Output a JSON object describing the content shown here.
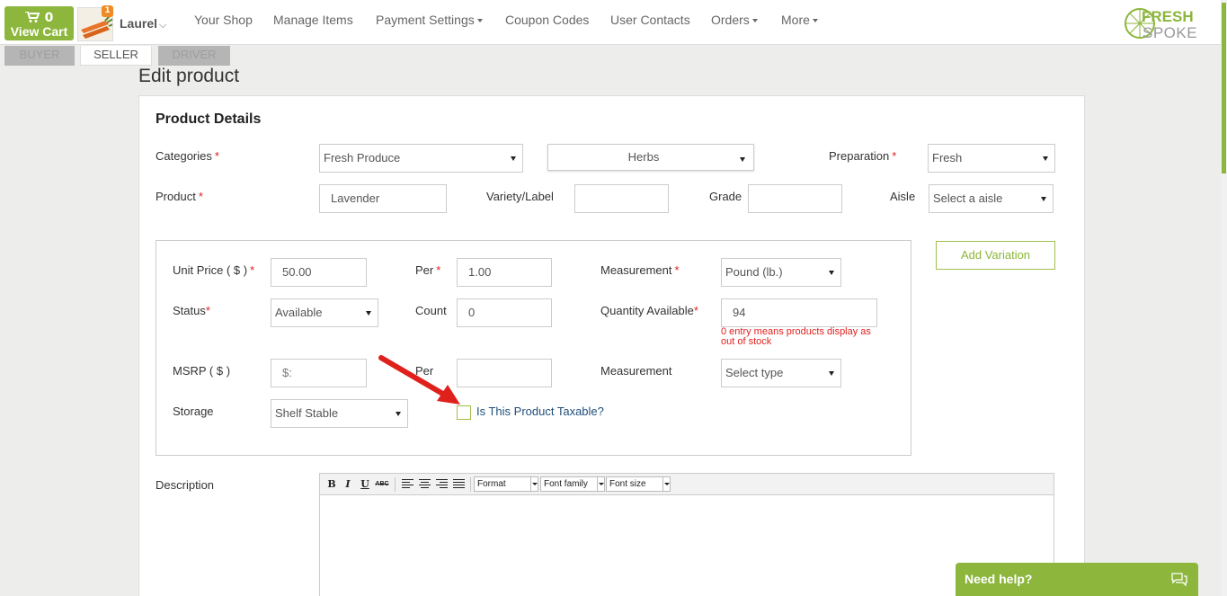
{
  "topbar": {
    "cart_count": "0",
    "cart_label": "View Cart",
    "notification_count": "1",
    "username": "Laurel",
    "nav": [
      {
        "label": "Your Shop",
        "dropdown": false
      },
      {
        "label": "Manage Items",
        "dropdown": false
      },
      {
        "label": "Payment Settings",
        "dropdown": true
      },
      {
        "label": "Coupon Codes",
        "dropdown": false
      },
      {
        "label": "User Contacts",
        "dropdown": false
      },
      {
        "label": "Orders",
        "dropdown": true
      },
      {
        "label": "More",
        "dropdown": true
      }
    ],
    "logo_top": "FRESH",
    "logo_bottom": "SPOKE"
  },
  "roles": {
    "buyer": "BUYER",
    "seller": "SELLER",
    "driver": "DRIVER",
    "active": "seller"
  },
  "page_title": "Edit product",
  "section_title": "Product Details",
  "form": {
    "categories_label": "Categories",
    "category_value": "Fresh Produce",
    "subcategory_value": "Herbs",
    "preparation_label": "Preparation",
    "preparation_value": "Fresh",
    "product_label": "Product",
    "product_value": "Lavender",
    "variety_label": "Variety/Label",
    "variety_value": "",
    "grade_label": "Grade",
    "grade_value": "",
    "aisle_label": "Aisle",
    "aisle_value": "Select a aisle",
    "unit_price_label": "Unit Price ( $ )",
    "unit_price_value": "50.00",
    "per_label": "Per",
    "per_value": "1.00",
    "measurement_label": "Measurement",
    "measurement_value": "Pound (lb.)",
    "status_label": "Status",
    "status_value": "Available",
    "count_label": "Count",
    "count_value": "0",
    "qty_label": "Quantity Available",
    "qty_value": "94",
    "qty_hint": "0 entry means products display as out of stock",
    "msrp_label": "MSRP ( $ )",
    "msrp_placeholder": "$:",
    "msrp_per_label": "Per",
    "msrp_per_value": "",
    "msrp_measurement_label": "Measurement",
    "msrp_measurement_value": "Select type",
    "storage_label": "Storage",
    "storage_value": "Shelf Stable",
    "taxable_label": "Is This Product Taxable?",
    "taxable_checked": false,
    "add_variation_label": "Add Variation",
    "description_label": "Description"
  },
  "editor": {
    "bold": "B",
    "italic": "I",
    "underline": "U",
    "strike": "ABC",
    "format_label": "Format",
    "font_family_label": "Font family",
    "font_size_label": "Font size"
  },
  "help": {
    "label": "Need help?"
  },
  "colors": {
    "brand_green": "#8cb63c",
    "required_red": "#e02020",
    "arrow_red": "#e0211b"
  }
}
